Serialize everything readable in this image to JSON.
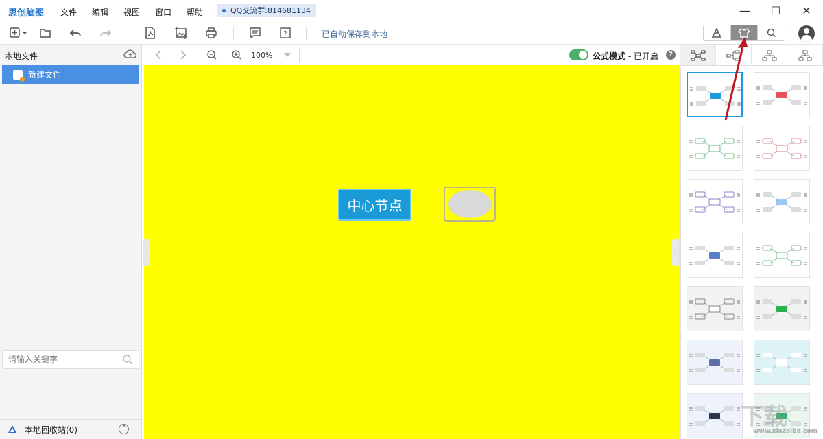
{
  "app": {
    "title": "思创脑图"
  },
  "menu": [
    "文件",
    "编辑",
    "视图",
    "窗口",
    "帮助"
  ],
  "qq_badge": "QQ交流群:814681134",
  "toolbar": {
    "autosave_label": "已自动保存到本地"
  },
  "left_panel": {
    "header": "本地文件",
    "file_name": "新建文件",
    "search_placeholder": "请输入关键字",
    "recycle_label": "本地回收站(0)"
  },
  "canvas_bar": {
    "zoom": "100%",
    "mode_label": "公式模式",
    "mode_status": " - 已开启"
  },
  "mindmap": {
    "center_text": "中心节点",
    "canvas_color": "#ffff00",
    "center_color": "#1a9bd7"
  },
  "theme_thumbs": [
    {
      "accent": "#1b9ae0",
      "style": "filled",
      "bg": "#ffffff"
    },
    {
      "accent": "#e8505b",
      "style": "filled",
      "bg": "#ffffff"
    },
    {
      "accent": "#6abf76",
      "style": "outline",
      "bg": "#ffffff"
    },
    {
      "accent": "#e8828a",
      "style": "outline",
      "bg": "#ffffff"
    },
    {
      "accent": "#8b86c8",
      "style": "outline",
      "bg": "#ffffff"
    },
    {
      "accent": "#9cc7ee",
      "style": "filled",
      "bg": "#ffffff"
    },
    {
      "accent": "#5c7fc9",
      "style": "filled",
      "bg": "#ffffff"
    },
    {
      "accent": "#6abf76",
      "style": "outline",
      "bg": "#ffffff"
    },
    {
      "accent": "#888888",
      "style": "outline",
      "bg": "#f2f2f2"
    },
    {
      "accent": "#2bb24c",
      "style": "filled",
      "bg": "#f2f2f2"
    },
    {
      "accent": "#5b6eaa",
      "style": "filled",
      "bg": "#eef2fa"
    },
    {
      "accent": "#ffffff",
      "style": "filled",
      "bg": "#dff2f6"
    },
    {
      "accent": "#2b3446",
      "style": "filled",
      "bg": "#eef2fa"
    },
    {
      "accent": "#2bb26c",
      "style": "filled",
      "bg": "#eaf6ef"
    }
  ],
  "watermark": {
    "text": "下载",
    "url": "www.xiazaiba.com"
  }
}
